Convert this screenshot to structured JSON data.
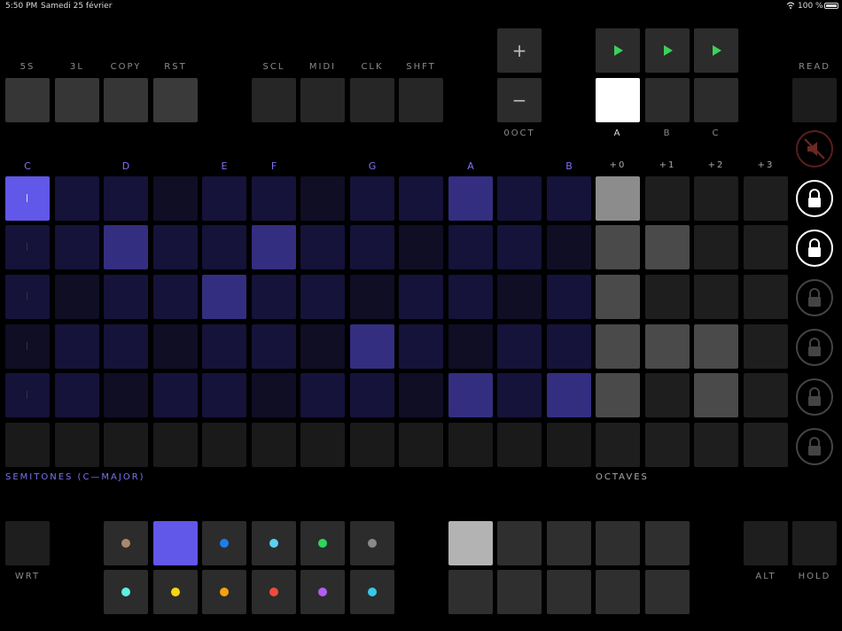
{
  "status": {
    "time": "5:50 PM",
    "date": "Samedi 25 février",
    "battery": "100 %",
    "wifi_icon": "wifi-icon",
    "battery_icon": "battery-icon"
  },
  "top_buttons": [
    "5S",
    "3L",
    "COPY",
    "RST"
  ],
  "top_buttons2": [
    "SCL",
    "MIDI",
    "CLK",
    "SHFT"
  ],
  "octave": {
    "plus": "+",
    "minus": "−",
    "label": "0OCT"
  },
  "tracks": {
    "labels": [
      "A",
      "B",
      "C"
    ],
    "selected": "A"
  },
  "read_label": "READ",
  "note_labels": [
    "C",
    "",
    "D",
    "",
    "E",
    "F",
    "",
    "G",
    "",
    "A",
    "",
    "B"
  ],
  "octave_labels": [
    "+0",
    "+1",
    "+2",
    "+3"
  ],
  "semitones_label": "SEMITONES (C—MAJOR)",
  "octaves_label": "OCTAVES",
  "grid": {
    "rows": [
      [
        "on",
        "d",
        "d",
        "d",
        "d",
        "d",
        "d",
        "d",
        "d",
        "m",
        "d",
        "d"
      ],
      [
        "d",
        "d",
        "m",
        "d",
        "d",
        "m",
        "d",
        "d",
        "d",
        "d",
        "d",
        "d"
      ],
      [
        "d",
        "d",
        "d",
        "d",
        "m",
        "d",
        "d",
        "d",
        "d",
        "d",
        "d",
        "d"
      ],
      [
        "d",
        "d",
        "d",
        "d",
        "d",
        "d",
        "d",
        "m",
        "d",
        "d",
        "d",
        "d"
      ],
      [
        "d",
        "d",
        "d",
        "d",
        "d",
        "d",
        "d",
        "d",
        "d",
        "m",
        "d",
        "m"
      ],
      [
        "b",
        "b",
        "b",
        "b",
        "b",
        "b",
        "b",
        "b",
        "b",
        "b",
        "b",
        "b"
      ]
    ],
    "octave_rows": [
      [
        "hi",
        "g",
        "g",
        "g"
      ],
      [
        "m",
        "m",
        "g",
        "g"
      ],
      [
        "m",
        "g",
        "g",
        "g"
      ],
      [
        "m",
        "m",
        "m",
        "g"
      ],
      [
        "m",
        "g",
        "m",
        "g"
      ],
      [
        "g",
        "g",
        "g",
        "g"
      ]
    ]
  },
  "locks": [
    "muted",
    "locked",
    "locked",
    "unlocked",
    "unlocked",
    "unlocked",
    "unlocked"
  ],
  "wrt_label": "WRT",
  "alt_label": "ALT",
  "hold_label": "HOLD",
  "palette": {
    "row1": [
      "#a88a6a",
      "SELECTED",
      "#1e7ee8",
      "#5ad1f0",
      "#2fd65a",
      "#8a8a8a"
    ],
    "row2": [
      "#5ef0e0",
      "#f5d60f",
      "#f5a20f",
      "#f04a3a",
      "#b15ef0",
      "#3ac8e8"
    ]
  },
  "colors": {
    "accent": "#6157e8",
    "mid": "#332e80",
    "dim": "#15133a",
    "lowdim": "#0f0e25"
  }
}
